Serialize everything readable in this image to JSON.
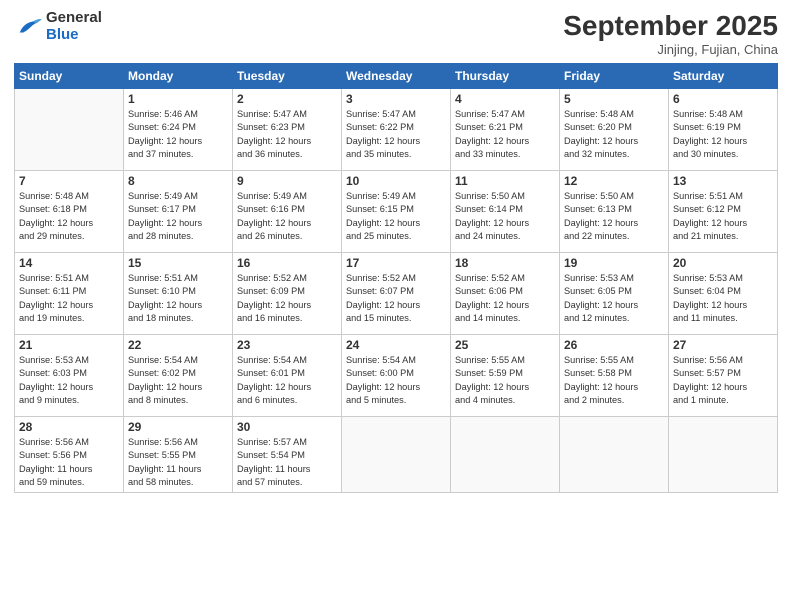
{
  "logo": {
    "line1": "General",
    "line2": "Blue"
  },
  "title": "September 2025",
  "subtitle": "Jinjing, Fujian, China",
  "weekdays": [
    "Sunday",
    "Monday",
    "Tuesday",
    "Wednesday",
    "Thursday",
    "Friday",
    "Saturday"
  ],
  "weeks": [
    [
      {
        "day": "",
        "info": ""
      },
      {
        "day": "1",
        "info": "Sunrise: 5:46 AM\nSunset: 6:24 PM\nDaylight: 12 hours\nand 37 minutes."
      },
      {
        "day": "2",
        "info": "Sunrise: 5:47 AM\nSunset: 6:23 PM\nDaylight: 12 hours\nand 36 minutes."
      },
      {
        "day": "3",
        "info": "Sunrise: 5:47 AM\nSunset: 6:22 PM\nDaylight: 12 hours\nand 35 minutes."
      },
      {
        "day": "4",
        "info": "Sunrise: 5:47 AM\nSunset: 6:21 PM\nDaylight: 12 hours\nand 33 minutes."
      },
      {
        "day": "5",
        "info": "Sunrise: 5:48 AM\nSunset: 6:20 PM\nDaylight: 12 hours\nand 32 minutes."
      },
      {
        "day": "6",
        "info": "Sunrise: 5:48 AM\nSunset: 6:19 PM\nDaylight: 12 hours\nand 30 minutes."
      }
    ],
    [
      {
        "day": "7",
        "info": "Sunrise: 5:48 AM\nSunset: 6:18 PM\nDaylight: 12 hours\nand 29 minutes."
      },
      {
        "day": "8",
        "info": "Sunrise: 5:49 AM\nSunset: 6:17 PM\nDaylight: 12 hours\nand 28 minutes."
      },
      {
        "day": "9",
        "info": "Sunrise: 5:49 AM\nSunset: 6:16 PM\nDaylight: 12 hours\nand 26 minutes."
      },
      {
        "day": "10",
        "info": "Sunrise: 5:49 AM\nSunset: 6:15 PM\nDaylight: 12 hours\nand 25 minutes."
      },
      {
        "day": "11",
        "info": "Sunrise: 5:50 AM\nSunset: 6:14 PM\nDaylight: 12 hours\nand 24 minutes."
      },
      {
        "day": "12",
        "info": "Sunrise: 5:50 AM\nSunset: 6:13 PM\nDaylight: 12 hours\nand 22 minutes."
      },
      {
        "day": "13",
        "info": "Sunrise: 5:51 AM\nSunset: 6:12 PM\nDaylight: 12 hours\nand 21 minutes."
      }
    ],
    [
      {
        "day": "14",
        "info": "Sunrise: 5:51 AM\nSunset: 6:11 PM\nDaylight: 12 hours\nand 19 minutes."
      },
      {
        "day": "15",
        "info": "Sunrise: 5:51 AM\nSunset: 6:10 PM\nDaylight: 12 hours\nand 18 minutes."
      },
      {
        "day": "16",
        "info": "Sunrise: 5:52 AM\nSunset: 6:09 PM\nDaylight: 12 hours\nand 16 minutes."
      },
      {
        "day": "17",
        "info": "Sunrise: 5:52 AM\nSunset: 6:07 PM\nDaylight: 12 hours\nand 15 minutes."
      },
      {
        "day": "18",
        "info": "Sunrise: 5:52 AM\nSunset: 6:06 PM\nDaylight: 12 hours\nand 14 minutes."
      },
      {
        "day": "19",
        "info": "Sunrise: 5:53 AM\nSunset: 6:05 PM\nDaylight: 12 hours\nand 12 minutes."
      },
      {
        "day": "20",
        "info": "Sunrise: 5:53 AM\nSunset: 6:04 PM\nDaylight: 12 hours\nand 11 minutes."
      }
    ],
    [
      {
        "day": "21",
        "info": "Sunrise: 5:53 AM\nSunset: 6:03 PM\nDaylight: 12 hours\nand 9 minutes."
      },
      {
        "day": "22",
        "info": "Sunrise: 5:54 AM\nSunset: 6:02 PM\nDaylight: 12 hours\nand 8 minutes."
      },
      {
        "day": "23",
        "info": "Sunrise: 5:54 AM\nSunset: 6:01 PM\nDaylight: 12 hours\nand 6 minutes."
      },
      {
        "day": "24",
        "info": "Sunrise: 5:54 AM\nSunset: 6:00 PM\nDaylight: 12 hours\nand 5 minutes."
      },
      {
        "day": "25",
        "info": "Sunrise: 5:55 AM\nSunset: 5:59 PM\nDaylight: 12 hours\nand 4 minutes."
      },
      {
        "day": "26",
        "info": "Sunrise: 5:55 AM\nSunset: 5:58 PM\nDaylight: 12 hours\nand 2 minutes."
      },
      {
        "day": "27",
        "info": "Sunrise: 5:56 AM\nSunset: 5:57 PM\nDaylight: 12 hours\nand 1 minute."
      }
    ],
    [
      {
        "day": "28",
        "info": "Sunrise: 5:56 AM\nSunset: 5:56 PM\nDaylight: 11 hours\nand 59 minutes."
      },
      {
        "day": "29",
        "info": "Sunrise: 5:56 AM\nSunset: 5:55 PM\nDaylight: 11 hours\nand 58 minutes."
      },
      {
        "day": "30",
        "info": "Sunrise: 5:57 AM\nSunset: 5:54 PM\nDaylight: 11 hours\nand 57 minutes."
      },
      {
        "day": "",
        "info": ""
      },
      {
        "day": "",
        "info": ""
      },
      {
        "day": "",
        "info": ""
      },
      {
        "day": "",
        "info": ""
      }
    ]
  ]
}
